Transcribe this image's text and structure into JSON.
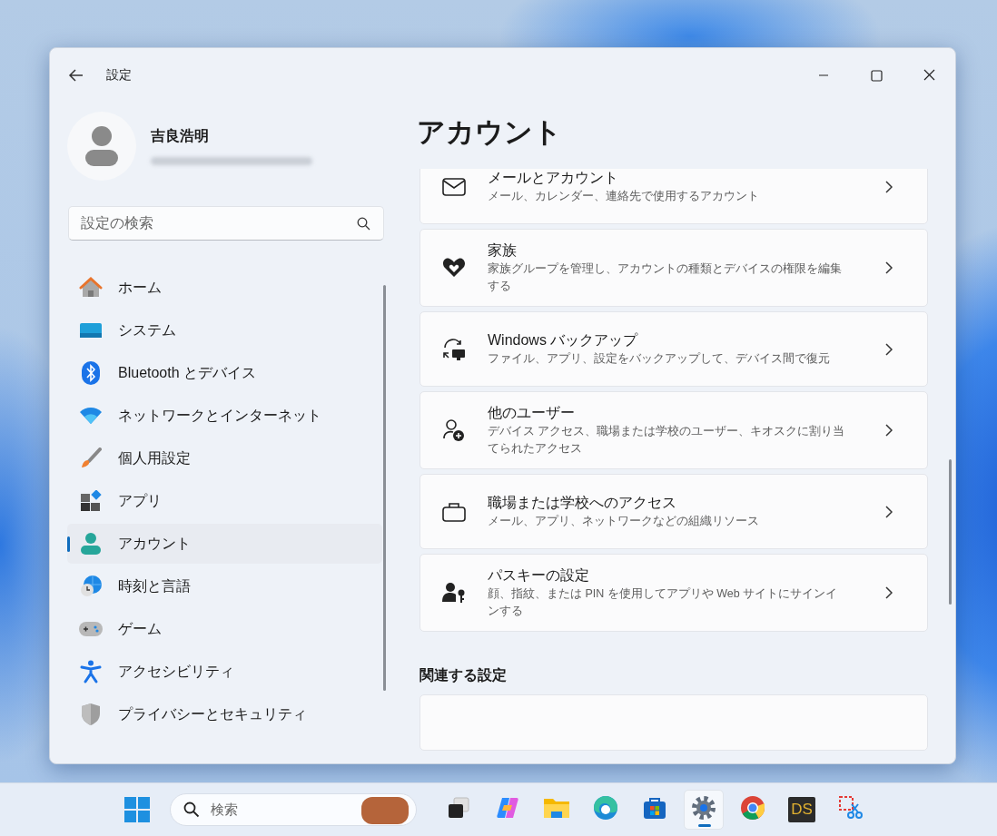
{
  "window": {
    "title": "設定"
  },
  "profile": {
    "name": "吉良浩明"
  },
  "search": {
    "placeholder": "設定の検索"
  },
  "nav": [
    {
      "kind": "home",
      "label": "ホーム",
      "selected": false
    },
    {
      "kind": "system",
      "label": "システム",
      "selected": false
    },
    {
      "kind": "bluetooth",
      "label": "Bluetooth とデバイス",
      "selected": false
    },
    {
      "kind": "wifi",
      "label": "ネットワークとインターネット",
      "selected": false
    },
    {
      "kind": "brush",
      "label": "個人用設定",
      "selected": false
    },
    {
      "kind": "apps",
      "label": "アプリ",
      "selected": false
    },
    {
      "kind": "account",
      "label": "アカウント",
      "selected": true
    },
    {
      "kind": "time",
      "label": "時刻と言語",
      "selected": false
    },
    {
      "kind": "game",
      "label": "ゲーム",
      "selected": false
    },
    {
      "kind": "accessibility",
      "label": "アクセシビリティ",
      "selected": false
    },
    {
      "kind": "shield",
      "label": "プライバシーとセキュリティ",
      "selected": false
    }
  ],
  "page": {
    "title": "アカウント"
  },
  "cards": [
    {
      "kind": "mail",
      "title": "メールとアカウント",
      "description": "メール、カレンダー、連絡先で使用するアカウント"
    },
    {
      "kind": "family",
      "title": "家族",
      "description": "家族グループを管理し、アカウントの種類とデバイスの権限を編集する"
    },
    {
      "kind": "backup",
      "title": "Windows バックアップ",
      "description": "ファイル、アプリ、設定をバックアップして、デバイス間で復元"
    },
    {
      "kind": "users",
      "title": "他のユーザー",
      "description": "デバイス アクセス、職場または学校のユーザー、キオスクに割り当てられたアクセス"
    },
    {
      "kind": "briefcase",
      "title": "職場または学校へのアクセス",
      "description": "メール、アプリ、ネットワークなどの組織リソース"
    },
    {
      "kind": "passkey",
      "title": "パスキーの設定",
      "description": "顔、指紋、または PIN を使用してアプリや Web サイトにサインインする"
    }
  ],
  "related": {
    "heading": "関連する設定"
  },
  "taskbar": {
    "search": {
      "placeholder": "検索"
    },
    "apps": [
      {
        "kind": "taskview",
        "selected": false
      },
      {
        "kind": "copilot",
        "selected": false
      },
      {
        "kind": "folder",
        "selected": false
      },
      {
        "kind": "edge",
        "selected": false
      },
      {
        "kind": "store",
        "selected": false
      },
      {
        "kind": "gear",
        "selected": true
      },
      {
        "kind": "chrome",
        "selected": false
      },
      {
        "kind": "ds",
        "text": "DS",
        "selected": false
      },
      {
        "kind": "snip",
        "selected": false
      }
    ]
  }
}
